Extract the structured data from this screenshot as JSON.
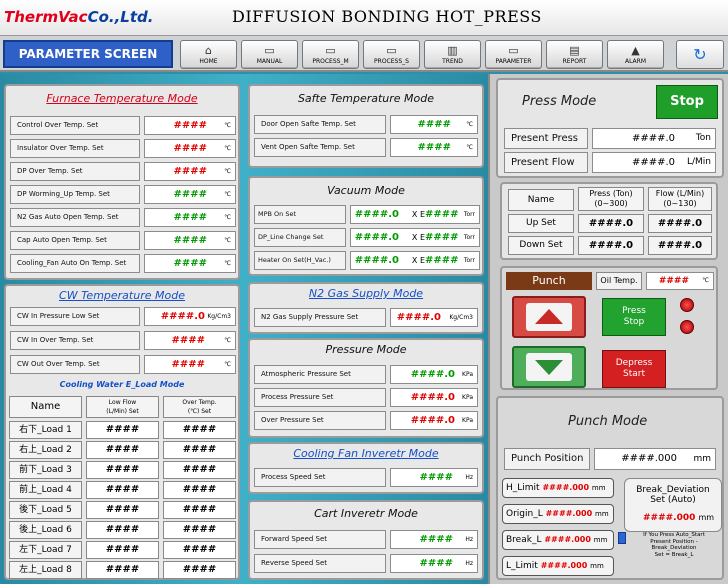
{
  "header": {
    "logo_a": "ThermVac",
    "logo_b": "Co.,Ltd.",
    "title": "DIFFUSION BONDING HOT_PRESS"
  },
  "nav": {
    "screen_label": "PARAMETER SCREEN",
    "buttons": [
      "HOME",
      "MANUAL",
      "PROCESS_M",
      "PROCESS_S",
      "TREND",
      "PARAMETER",
      "REPORT",
      "ALARM"
    ]
  },
  "furnace": {
    "title": "Furnace Temperature Mode",
    "rows": [
      {
        "label": "Control Over Temp. Set",
        "value": "####",
        "unit": "℃",
        "color": "red"
      },
      {
        "label": "Insulator Over Temp. Set",
        "value": "####",
        "unit": "℃",
        "color": "red"
      },
      {
        "label": "DP Over Temp. Set",
        "value": "####",
        "unit": "℃",
        "color": "red"
      },
      {
        "label": "DP Worming_Up Temp. Set",
        "value": "####",
        "unit": "℃",
        "color": "grn"
      },
      {
        "label": "N2 Gas Auto Open Temp. Set",
        "value": "####",
        "unit": "℃",
        "color": "grn"
      },
      {
        "label": "Cap Auto Open Temp. Set",
        "value": "####",
        "unit": "℃",
        "color": "grn"
      },
      {
        "label": "Cooling_Fan Auto On Temp. Set",
        "value": "####",
        "unit": "℃",
        "color": "grn"
      }
    ]
  },
  "cw": {
    "title": "CW Temperature Mode",
    "rows": [
      {
        "label": "CW In Pressure Low Set",
        "value": "####.0",
        "unit": "Kg/Cm3",
        "color": "red"
      },
      {
        "label": "CW In Over Temp. Set",
        "value": "####",
        "unit": "℃",
        "color": "red"
      },
      {
        "label": "CW Out Over Temp. Set",
        "value": "####",
        "unit": "℃",
        "color": "red"
      }
    ],
    "eload_title": "Cooling Water  E_Load Mode",
    "col_name": "Name",
    "col_flow": "Low Flow\n(L/Min) Set",
    "col_temp": "Over Temp.\n(℃) Set",
    "loads": [
      {
        "name": "右下_Load 1",
        "flow": "####",
        "temp": "####"
      },
      {
        "name": "右上_Load 2",
        "flow": "####",
        "temp": "####"
      },
      {
        "name": "前下_Load 3",
        "flow": "####",
        "temp": "####"
      },
      {
        "name": "前上_Load 4",
        "flow": "####",
        "temp": "####"
      },
      {
        "name": "後下_Load 5",
        "flow": "####",
        "temp": "####"
      },
      {
        "name": "後上_Load 6",
        "flow": "####",
        "temp": "####"
      },
      {
        "name": "左下_Load 7",
        "flow": "####",
        "temp": "####"
      },
      {
        "name": "左上_Load 8",
        "flow": "####",
        "temp": "####"
      }
    ]
  },
  "safety": {
    "title": "Safte Temperature Mode",
    "rows": [
      {
        "label": "Door Open Safte Temp. Set",
        "value": "####",
        "unit": "℃",
        "color": "grn"
      },
      {
        "label": "Vent Open Safte Temp. Set",
        "value": "####",
        "unit": "℃",
        "color": "grn"
      }
    ]
  },
  "vacuum": {
    "title": "Vacuum Mode",
    "rows": [
      {
        "label": "MPB On Set",
        "value": "####.0",
        "exp": "X E",
        "expval": "####",
        "unit": "Torr"
      },
      {
        "label": "DP_Line Change Set",
        "value": "####.0",
        "exp": "X E",
        "expval": "####",
        "unit": "Torr"
      },
      {
        "label": "Heater On Set(H_Vac.)",
        "value": "####.0",
        "exp": "X E",
        "expval": "####",
        "unit": "Torr"
      }
    ]
  },
  "n2": {
    "title": "N2 Gas Supply Mode",
    "rows": [
      {
        "label": "N2 Gas Supply Pressure Set",
        "value": "####.0",
        "unit": "Kg/Cm3",
        "color": "red"
      }
    ]
  },
  "pressure": {
    "title": "Pressure Mode",
    "rows": [
      {
        "label": "Atmospheric Pressure Set",
        "value": "####.0",
        "unit": "KPa",
        "color": "grn"
      },
      {
        "label": "Process Pressure Set",
        "value": "####.0",
        "unit": "KPa",
        "color": "red"
      },
      {
        "label": "Over Pressure Set",
        "value": "####.0",
        "unit": "KPa",
        "color": "red"
      }
    ]
  },
  "fan": {
    "title": "Cooling Fan Inveretr Mode",
    "rows": [
      {
        "label": "Process Speed Set",
        "value": "####",
        "unit": "Hz",
        "color": "grn"
      }
    ]
  },
  "cart": {
    "title": "Cart Inveretr Mode",
    "rows": [
      {
        "label": "Forward Speed Set",
        "value": "####",
        "unit": "Hz",
        "color": "grn"
      },
      {
        "label": "Reverse Speed Set",
        "value": "####",
        "unit": "Hz",
        "color": "grn"
      }
    ]
  },
  "press_mode": {
    "title": "Press Mode",
    "stop_label": "Stop",
    "present_press_label": "Present Press",
    "present_press_value": "####.0",
    "present_press_unit": "Ton",
    "present_flow_label": "Present Flow",
    "present_flow_value": "####.0",
    "present_flow_unit": "L/Min",
    "col_name": "Name",
    "col_press": "Press (Ton)\n(0~300)",
    "col_flow": "Flow (L/Min)\n(0~130)",
    "up_label": "Up Set",
    "up_press": "####.0",
    "up_flow": "####.0",
    "down_label": "Down Set",
    "down_press": "####.0",
    "down_flow": "####.0",
    "punch_label": "Punch",
    "oil_label": "Oil Temp.",
    "oil_value": "####",
    "oil_unit": "℃",
    "press_stop_label": "Press\nStop",
    "depress_label": "Depress\nStart"
  },
  "punch_mode": {
    "title": "Punch Mode",
    "position_label": "Punch Position",
    "position_value": "####.000",
    "position_unit": "mm",
    "limits": [
      {
        "label": "H_Limit",
        "value": "####.000",
        "unit": "mm"
      },
      {
        "label": "Origin_L",
        "value": "####.000",
        "unit": "mm"
      },
      {
        "label": "Break_L",
        "value": "####.000",
        "unit": "mm"
      },
      {
        "label": "L_Limit",
        "value": "####.000",
        "unit": "mm"
      }
    ],
    "deviation_title": "Break_Deviation\nSet (Auto)",
    "deviation_value": "####.000",
    "deviation_unit": "mm",
    "note": "If You Press Auto_Start\nPresent Position -\nBreak_Deviation\nSet = Break_L"
  }
}
